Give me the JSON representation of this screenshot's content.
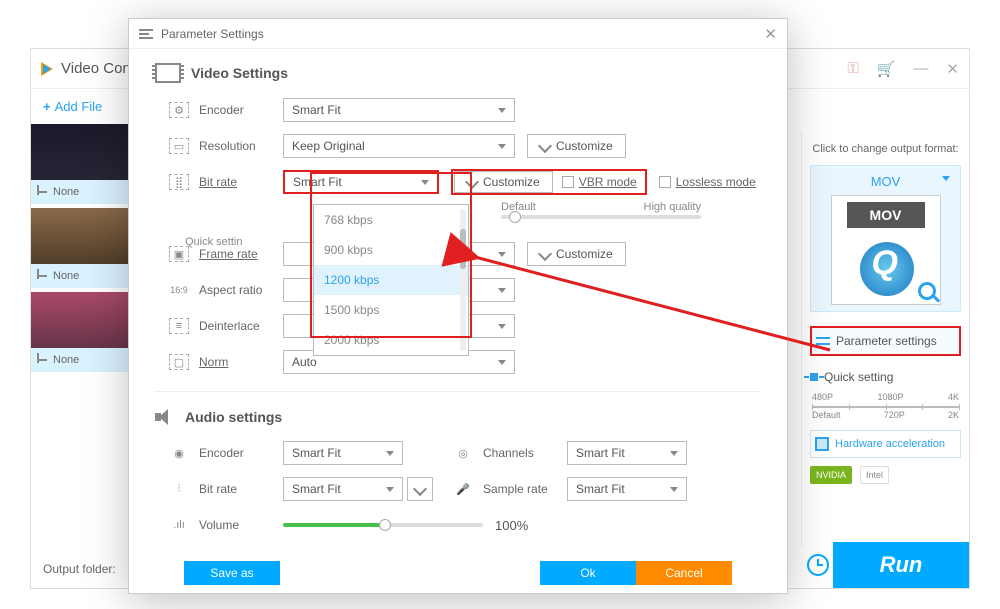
{
  "main": {
    "title": "Video Conv",
    "add_file": "Add File",
    "thumb_caption": "None",
    "output_folder_label": "Output folder:",
    "run": "Run"
  },
  "win_controls": {
    "minimize": "—",
    "close": "✕"
  },
  "side": {
    "title": "Click to change output format:",
    "format": "MOV",
    "format_label": "MOV",
    "param_btn": "Parameter settings",
    "quick": "Quick setting",
    "res": {
      "r1": "480P",
      "r2": "1080P",
      "r3": "4K",
      "r4": "Default",
      "r5": "720P",
      "r6": "2K"
    },
    "hw": "Hardware acceleration",
    "nvidia": "NVIDIA",
    "intel": "Intel"
  },
  "dialog": {
    "title": "Parameter Settings",
    "video_section": "Video Settings",
    "audio_section": "Audio settings",
    "labels": {
      "encoder": "Encoder",
      "resolution": "Resolution",
      "bitrate": "Bit rate",
      "framerate": "Frame rate",
      "aspect": "Aspect ratio",
      "deinterlace": "Deinterlace",
      "norm": "Norm",
      "channels": "Channels",
      "samplerate": "Sample rate",
      "volume": "Volume",
      "quick": "Quick settin"
    },
    "values": {
      "encoder": "Smart Fit",
      "resolution": "Keep Original",
      "bitrate": "Smart Fit",
      "norm": "Auto",
      "a_encoder": "Smart Fit",
      "a_bitrate": "Smart Fit",
      "channels": "Smart Fit",
      "samplerate": "Smart Fit",
      "volume_pct": "100%"
    },
    "buttons": {
      "customize": "Customize",
      "ok": "Ok",
      "cancel": "Cancel",
      "save": "Save as"
    },
    "vbr": "VBR mode",
    "lossless": "Lossless mode",
    "slider": {
      "left": "Default",
      "right": "High quality"
    },
    "dropdown": [
      "768 kbps",
      "900 kbps",
      "1200 kbps",
      "1500 kbps",
      "2000 kbps"
    ],
    "icons": {
      "aspect": "16:9"
    }
  }
}
